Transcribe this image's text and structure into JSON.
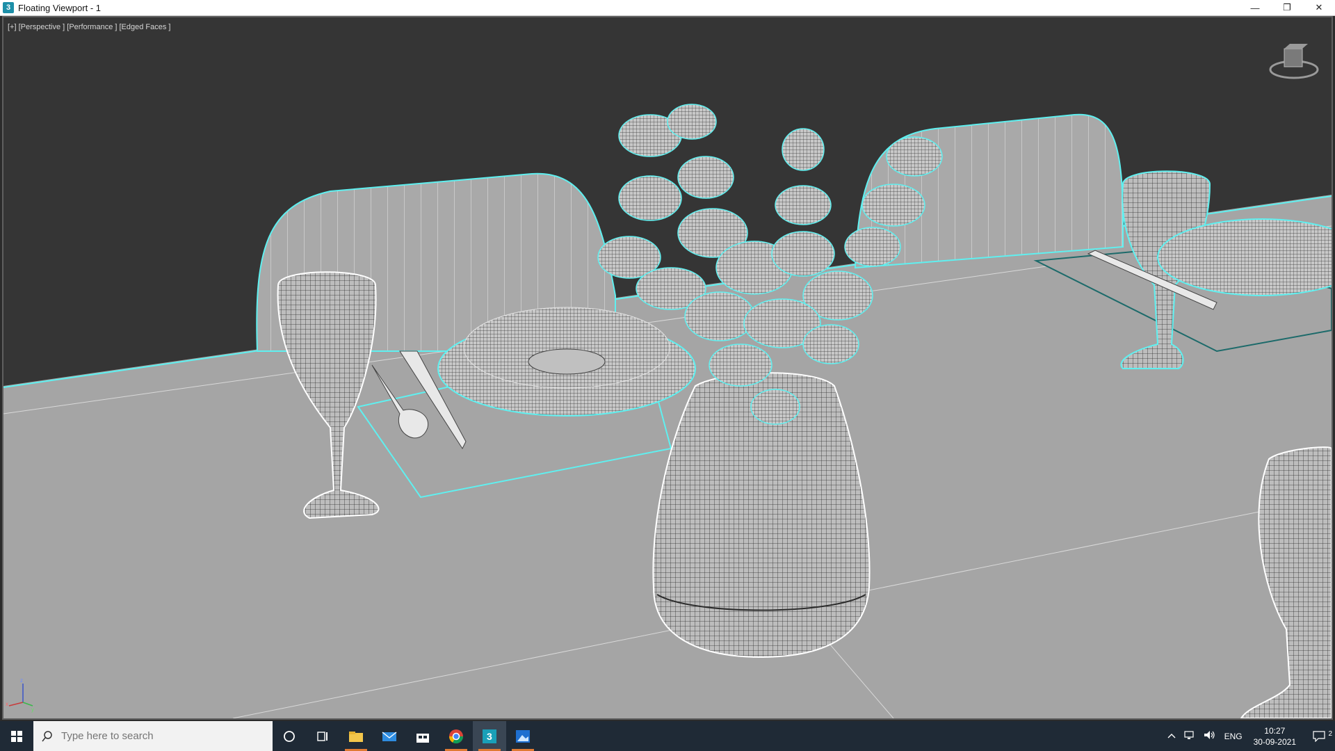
{
  "window": {
    "title": "Floating Viewport - 1",
    "app_icon_glyph": "3",
    "minimize_glyph": "—",
    "restore_glyph": "❐",
    "close_glyph": "✕"
  },
  "viewport": {
    "label": "[+] [Perspective ] [Performance ] [Edged Faces ]",
    "background_color": "#353535",
    "table_color": "#a5a5a5",
    "selection_color": "#5ff0f0"
  },
  "taskbar": {
    "search_placeholder": "Type here to search",
    "apps": [
      "cortana-icon",
      "task-view-icon",
      "file-explorer-icon",
      "mail-icon",
      "store-icon",
      "chrome-icon",
      "3dsmax-icon",
      "photos-icon"
    ],
    "language": "ENG",
    "time": "10:27",
    "date": "30-09-2021",
    "notification_count": "2"
  }
}
